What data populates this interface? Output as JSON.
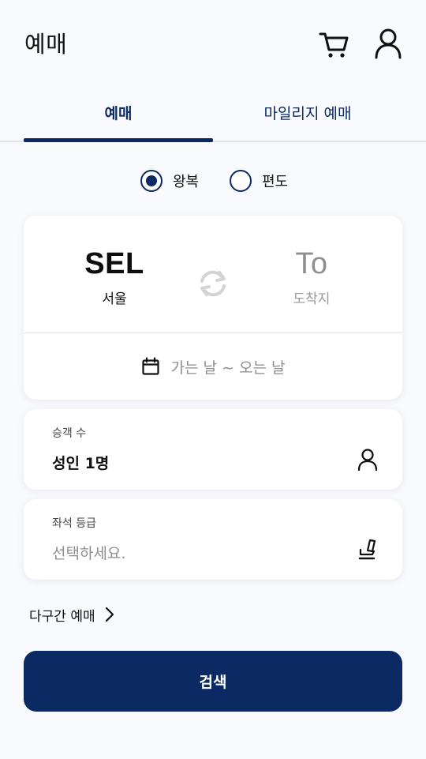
{
  "header": {
    "title": "예매",
    "cart_icon": "cart-icon",
    "user_icon": "user-icon"
  },
  "tabs": [
    {
      "label": "예매",
      "active": true
    },
    {
      "label": "마일리지 예매",
      "active": false
    }
  ],
  "trip_type": {
    "options": [
      {
        "label": "왕복",
        "selected": true
      },
      {
        "label": "편도",
        "selected": false
      }
    ]
  },
  "route": {
    "from": {
      "code": "SEL",
      "city": "서울"
    },
    "to": {
      "code": "To",
      "city": "도착지"
    },
    "swap_icon": "swap-icon"
  },
  "dates": {
    "placeholder": "가는 날 ~ 오는 날",
    "icon": "calendar-icon"
  },
  "passengers": {
    "label": "승객 수",
    "value": "성인 1명",
    "icon": "person-icon"
  },
  "seat_class": {
    "label": "좌석 등급",
    "placeholder": "선택하세요.",
    "icon": "seat-icon"
  },
  "multi_city": {
    "label": "다구간 예매",
    "icon": "chevron-right-icon"
  },
  "search_button": {
    "label": "검색"
  },
  "colors": {
    "primary": "#0b2a63",
    "background": "#f9fafd",
    "muted_text": "#8e8e8e"
  }
}
